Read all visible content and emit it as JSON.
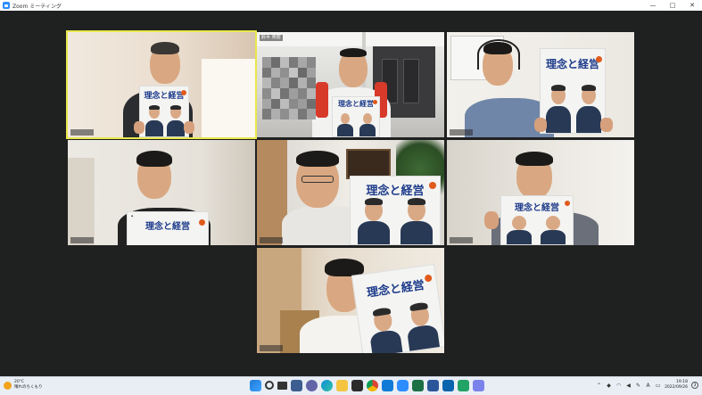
{
  "window": {
    "title": "Zoom ミーティング",
    "controls": [
      "—",
      "□",
      "✕"
    ]
  },
  "tiles": [
    {
      "id": "p1",
      "name": "",
      "active": true,
      "magazine": {
        "title": "理念と経営"
      }
    },
    {
      "id": "p2",
      "name": "鈴木 英樹",
      "active": false,
      "magazine": {
        "title": "理念と経営"
      }
    },
    {
      "id": "p3",
      "name": "",
      "active": false,
      "magazine": {
        "title": "理念と経営"
      }
    },
    {
      "id": "p4",
      "name": "",
      "active": false,
      "magazine": {
        "title": "理念と経営"
      }
    },
    {
      "id": "p5",
      "name": "",
      "active": false,
      "magazine": {
        "title": "理念と経営"
      }
    },
    {
      "id": "p6",
      "name": "",
      "active": false,
      "magazine": {
        "title": "理念と経営"
      }
    },
    {
      "id": "p7",
      "name": "",
      "active": false,
      "magazine": {
        "title": "理念と経営"
      }
    }
  ],
  "taskbar": {
    "weather_temp": "20°C",
    "weather_desc": "晴れのちくもり",
    "time": "19:18",
    "date": "2022/09/26",
    "ime_label": "A",
    "notifications": "3",
    "pinned_icons": [
      "windows-start-icon",
      "search-icon",
      "task-view-icon",
      "widgets-icon",
      "chat-icon",
      "edge-icon",
      "explorer-icon",
      "store-icon",
      "chrome-icon",
      "mail-icon",
      "zoom-icon",
      "excel-icon",
      "word-icon",
      "outlook-icon",
      "excel-green-icon",
      "teams-icon"
    ]
  },
  "colors": {
    "accent": "#2d8cff",
    "active_speaker": "#e8e84c",
    "magazine_blue": "#1d3b8b"
  }
}
